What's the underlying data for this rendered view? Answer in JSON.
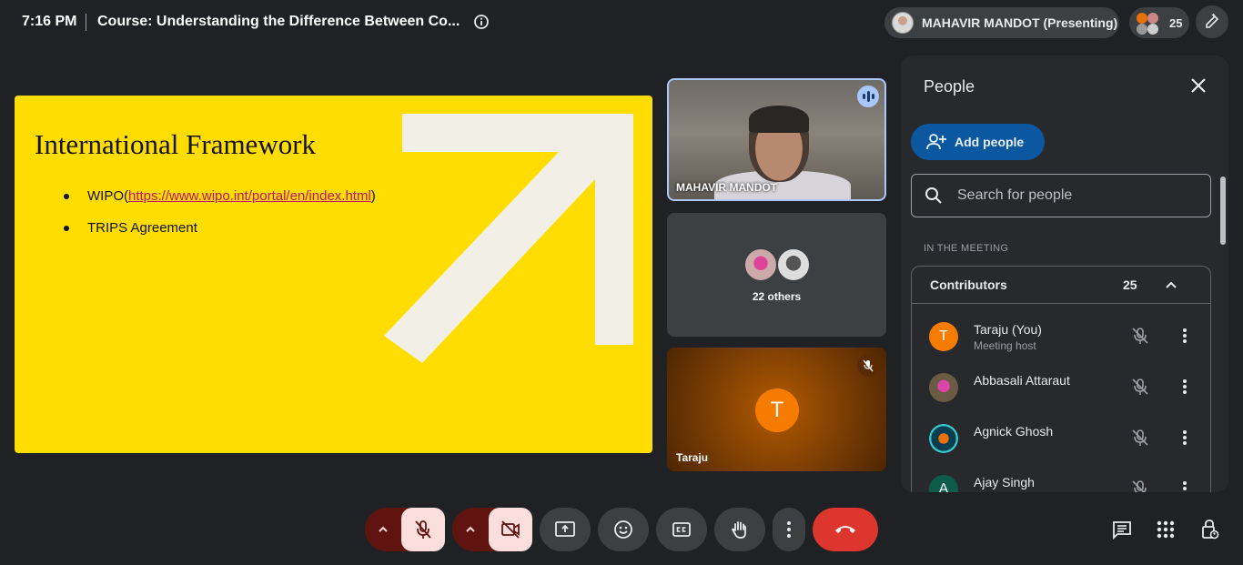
{
  "topbar": {
    "time": "7:16 PM",
    "title": "Course: Understanding the Difference Between Co...",
    "presenter_label": "MAHAVIR MANDOT (Presenting)",
    "participant_count": "25"
  },
  "slide": {
    "title": "International Framework",
    "bullet1_prefix": "WIPO(",
    "bullet1_link": "https://www.wipo.int/portal/en/index.html",
    "bullet1_suffix": ")",
    "bullet2": "TRIPS Agreement"
  },
  "tiles": {
    "speaker_name": "MAHAVIR MANDOT",
    "others_label": "22 others",
    "self_initial": "T",
    "self_name": "Taraju"
  },
  "people_panel": {
    "title": "People",
    "add_people": "Add people",
    "search_placeholder": "Search for people",
    "section_label": "IN THE MEETING",
    "contributors_label": "Contributors",
    "contributors_count": "25",
    "people": [
      {
        "name": "Taraju (You)",
        "sub": "Meeting host",
        "initial": "T",
        "color": "#f57c00"
      },
      {
        "name": "Abbasali Attaraut",
        "sub": "",
        "initial": "",
        "color": "#5b4a3a"
      },
      {
        "name": "Agnick Ghosh",
        "sub": "",
        "initial": "",
        "color": "#0a3d4f"
      },
      {
        "name": "Ajay Singh",
        "sub": "",
        "initial": "A",
        "color": "#0d5c4a"
      }
    ]
  },
  "colors": {
    "accent": "#a8c7fa",
    "leave_red": "#dc362e",
    "muted_bg": "#f9dedc",
    "slide_yellow": "#ffdd00"
  }
}
